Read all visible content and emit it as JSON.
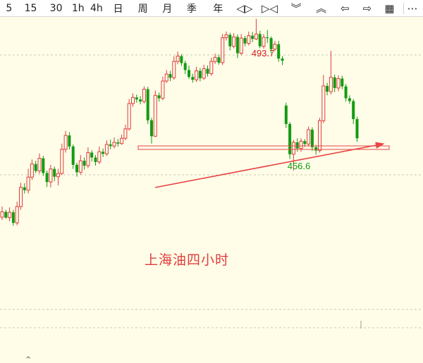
{
  "toolbar": {
    "periods": [
      "5",
      "15",
      "30",
      "1h",
      "4h",
      "日",
      "周",
      "月",
      "季",
      "年"
    ],
    "tools": [
      {
        "name": "diamond-left-icon",
        "glyph": "◁▷"
      },
      {
        "name": "bowtie-icon",
        "glyph": "▷◁"
      },
      {
        "name": "double-chevron-down-icon",
        "glyph": "︾"
      },
      {
        "name": "double-chevron-up-icon",
        "glyph": "︽"
      },
      {
        "name": "arrow-left-icon",
        "glyph": "⇦"
      },
      {
        "name": "arrow-right-icon",
        "glyph": "⇨"
      },
      {
        "name": "layout-grid-icon",
        "glyph": "▦"
      },
      {
        "name": "more-icon",
        "glyph": "⋯"
      }
    ]
  },
  "chart_data": {
    "type": "candlestick",
    "high_label": "493.7",
    "low_label": "456.6",
    "annotation": "上海油四小时",
    "colors": {
      "up": "#e03c3c",
      "down": "#129b12",
      "trendline": "#e84545",
      "support": "#e84545"
    },
    "candles": [
      [
        445.2,
        446.5,
        447.8,
        444.5
      ],
      [
        446.5,
        445.1,
        447.0,
        444.8
      ],
      [
        445.1,
        446.4,
        447.6,
        444.2
      ],
      [
        446.4,
        443.8,
        447.0,
        443.1
      ],
      [
        443.8,
        447.8,
        449.0,
        443.2
      ],
      [
        447.8,
        452.5,
        453.6,
        447.0
      ],
      [
        452.5,
        451.8,
        453.5,
        451.0
      ],
      [
        451.8,
        455.0,
        457.0,
        451.0
      ],
      [
        455.0,
        458.2,
        459.3,
        454.3
      ],
      [
        458.2,
        456.5,
        459.0,
        456.0
      ],
      [
        456.5,
        459.6,
        460.8,
        455.8
      ],
      [
        459.6,
        456.0,
        460.2,
        455.3
      ],
      [
        456.0,
        453.8,
        456.6,
        452.6
      ],
      [
        453.8,
        457.0,
        458.0,
        452.5
      ],
      [
        457.0,
        455.1,
        457.6,
        454.0
      ],
      [
        455.1,
        455.9,
        457.0,
        453.0
      ],
      [
        455.9,
        461.8,
        463.2,
        455.5
      ],
      [
        461.8,
        465.2,
        466.3,
        461.0
      ],
      [
        465.2,
        462.5,
        466.0,
        461.8
      ],
      [
        462.5,
        458.0,
        463.0,
        457.0
      ],
      [
        458.0,
        456.2,
        458.5,
        455.1
      ],
      [
        456.2,
        459.0,
        460.4,
        455.6
      ],
      [
        459.0,
        457.8,
        459.8,
        456.8
      ],
      [
        457.8,
        461.0,
        462.3,
        457.2
      ],
      [
        461.0,
        459.8,
        461.6,
        458.8
      ],
      [
        459.8,
        458.7,
        460.4,
        457.8
      ],
      [
        458.7,
        461.2,
        462.5,
        458.2
      ],
      [
        461.2,
        460.7,
        462.0,
        459.9
      ],
      [
        460.7,
        463.0,
        464.0,
        460.2
      ],
      [
        463.0,
        462.6,
        464.2,
        461.8
      ],
      [
        462.6,
        463.5,
        464.7,
        462.0
      ],
      [
        463.5,
        463.2,
        464.3,
        462.5
      ],
      [
        463.2,
        464.5,
        465.4,
        462.9
      ],
      [
        464.5,
        466.8,
        467.8,
        464.0
      ],
      [
        466.8,
        473.0,
        474.1,
        466.4
      ],
      [
        473.0,
        474.5,
        475.5,
        472.2
      ],
      [
        474.5,
        474.0,
        475.2,
        473.2
      ],
      [
        474.0,
        473.5,
        474.8,
        472.8
      ],
      [
        473.5,
        476.5,
        477.2,
        473.0
      ],
      [
        476.5,
        468.9,
        477.1,
        468.0
      ],
      [
        468.9,
        465.0,
        469.5,
        463.2
      ],
      [
        465.0,
        475.0,
        476.2,
        464.8
      ],
      [
        475.0,
        474.3,
        475.7,
        473.5
      ],
      [
        474.3,
        478.5,
        479.6,
        473.8
      ],
      [
        478.5,
        480.2,
        481.2,
        478.0
      ],
      [
        480.2,
        479.3,
        481.0,
        478.5
      ],
      [
        479.3,
        483.3,
        484.6,
        478.8
      ],
      [
        483.3,
        484.6,
        485.7,
        482.6
      ],
      [
        484.6,
        482.9,
        485.1,
        482.2
      ],
      [
        482.9,
        481.2,
        483.5,
        480.2
      ],
      [
        481.2,
        479.5,
        482.3,
        479.0
      ],
      [
        479.5,
        478.8,
        480.3,
        478.1
      ],
      [
        478.8,
        481.0,
        482.0,
        478.3
      ],
      [
        481.0,
        479.2,
        481.7,
        478.4
      ],
      [
        479.2,
        481.5,
        482.5,
        478.8
      ],
      [
        481.5,
        480.3,
        482.3,
        479.6
      ],
      [
        480.3,
        483.3,
        484.2,
        479.8
      ],
      [
        483.3,
        484.3,
        485.2,
        482.7
      ],
      [
        484.3,
        483.0,
        485.0,
        482.5
      ],
      [
        483.0,
        489.1,
        490.0,
        482.4
      ],
      [
        489.1,
        489.8,
        490.6,
        488.4
      ],
      [
        489.8,
        487.0,
        490.3,
        486.0
      ],
      [
        487.0,
        489.3,
        490.2,
        486.5
      ],
      [
        489.3,
        485.3,
        489.9,
        484.1
      ],
      [
        485.3,
        489.0,
        490.0,
        484.8
      ],
      [
        489.0,
        487.7,
        489.5,
        487.0
      ],
      [
        487.7,
        489.6,
        490.6,
        487.2
      ],
      [
        489.6,
        488.8,
        490.5,
        488.0
      ],
      [
        488.8,
        490.0,
        493.7,
        488.5
      ],
      [
        490.0,
        487.0,
        490.8,
        486.5
      ],
      [
        487.0,
        489.2,
        490.0,
        486.4
      ],
      [
        489.2,
        489.0,
        491.0,
        487.8
      ],
      [
        489.0,
        486.3,
        489.4,
        485.3
      ],
      [
        486.3,
        487.5,
        488.3,
        485.8
      ],
      [
        487.5,
        484.0,
        488.3,
        483.2
      ],
      [
        484.0,
        483.5,
        484.6,
        482.4
      ],
      [
        472.5,
        468.0,
        473.2,
        467.0
      ],
      [
        468.0,
        460.6,
        468.5,
        459.4
      ],
      [
        460.6,
        463.5,
        464.1,
        456.6
      ],
      [
        463.5,
        462.0,
        464.5,
        461.2
      ],
      [
        462.0,
        463.8,
        464.5,
        461.2
      ],
      [
        463.8,
        463.1,
        464.3,
        462.4
      ],
      [
        463.1,
        466.6,
        467.4,
        462.5
      ],
      [
        466.6,
        462.3,
        467.2,
        461.4
      ],
      [
        462.3,
        461.5,
        462.9,
        460.5
      ],
      [
        461.5,
        468.8,
        469.5,
        461.0
      ],
      [
        468.8,
        477.3,
        480.0,
        468.2
      ],
      [
        477.3,
        475.9,
        478.1,
        475.0
      ],
      [
        475.9,
        479.4,
        485.9,
        475.2
      ],
      [
        479.4,
        476.8,
        480.1,
        475.8
      ],
      [
        476.8,
        479.1,
        479.9,
        476.0
      ],
      [
        479.1,
        477.2,
        479.8,
        476.5
      ],
      [
        477.2,
        474.3,
        477.8,
        473.5
      ],
      [
        474.3,
        473.6,
        475.0,
        472.9
      ],
      [
        473.6,
        469.2,
        474.1,
        468.0
      ],
      [
        469.2,
        464.5,
        469.8,
        463.6
      ]
    ]
  }
}
